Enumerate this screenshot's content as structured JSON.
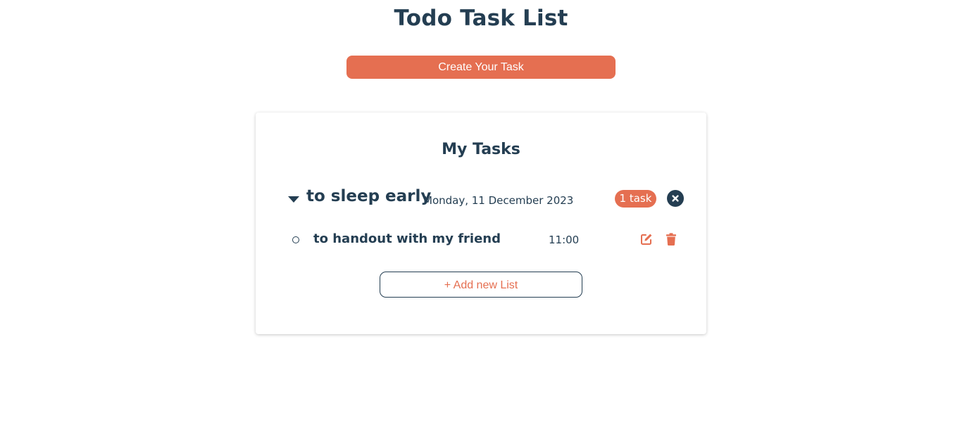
{
  "header": {
    "title": "Todo Task List",
    "create_button_label": "Create Your Task"
  },
  "card": {
    "title": "My Tasks",
    "lists": [
      {
        "name": "to sleep early",
        "date": "Monday, 11 December 2023",
        "count_label": "1 task",
        "expanded": true,
        "tasks": [
          {
            "name": "to handout with my friend",
            "time": "11:00",
            "done": false
          }
        ]
      }
    ],
    "add_list_label": "+ Add new List"
  },
  "icons": {
    "expand": "caret-down-icon",
    "close": "close-circle-icon",
    "task_status": "circle-outline-icon",
    "edit": "edit-icon",
    "delete": "trash-icon"
  },
  "colors": {
    "primary_text": "#243e52",
    "accent": "#e56f51",
    "background": "#ffffff"
  }
}
